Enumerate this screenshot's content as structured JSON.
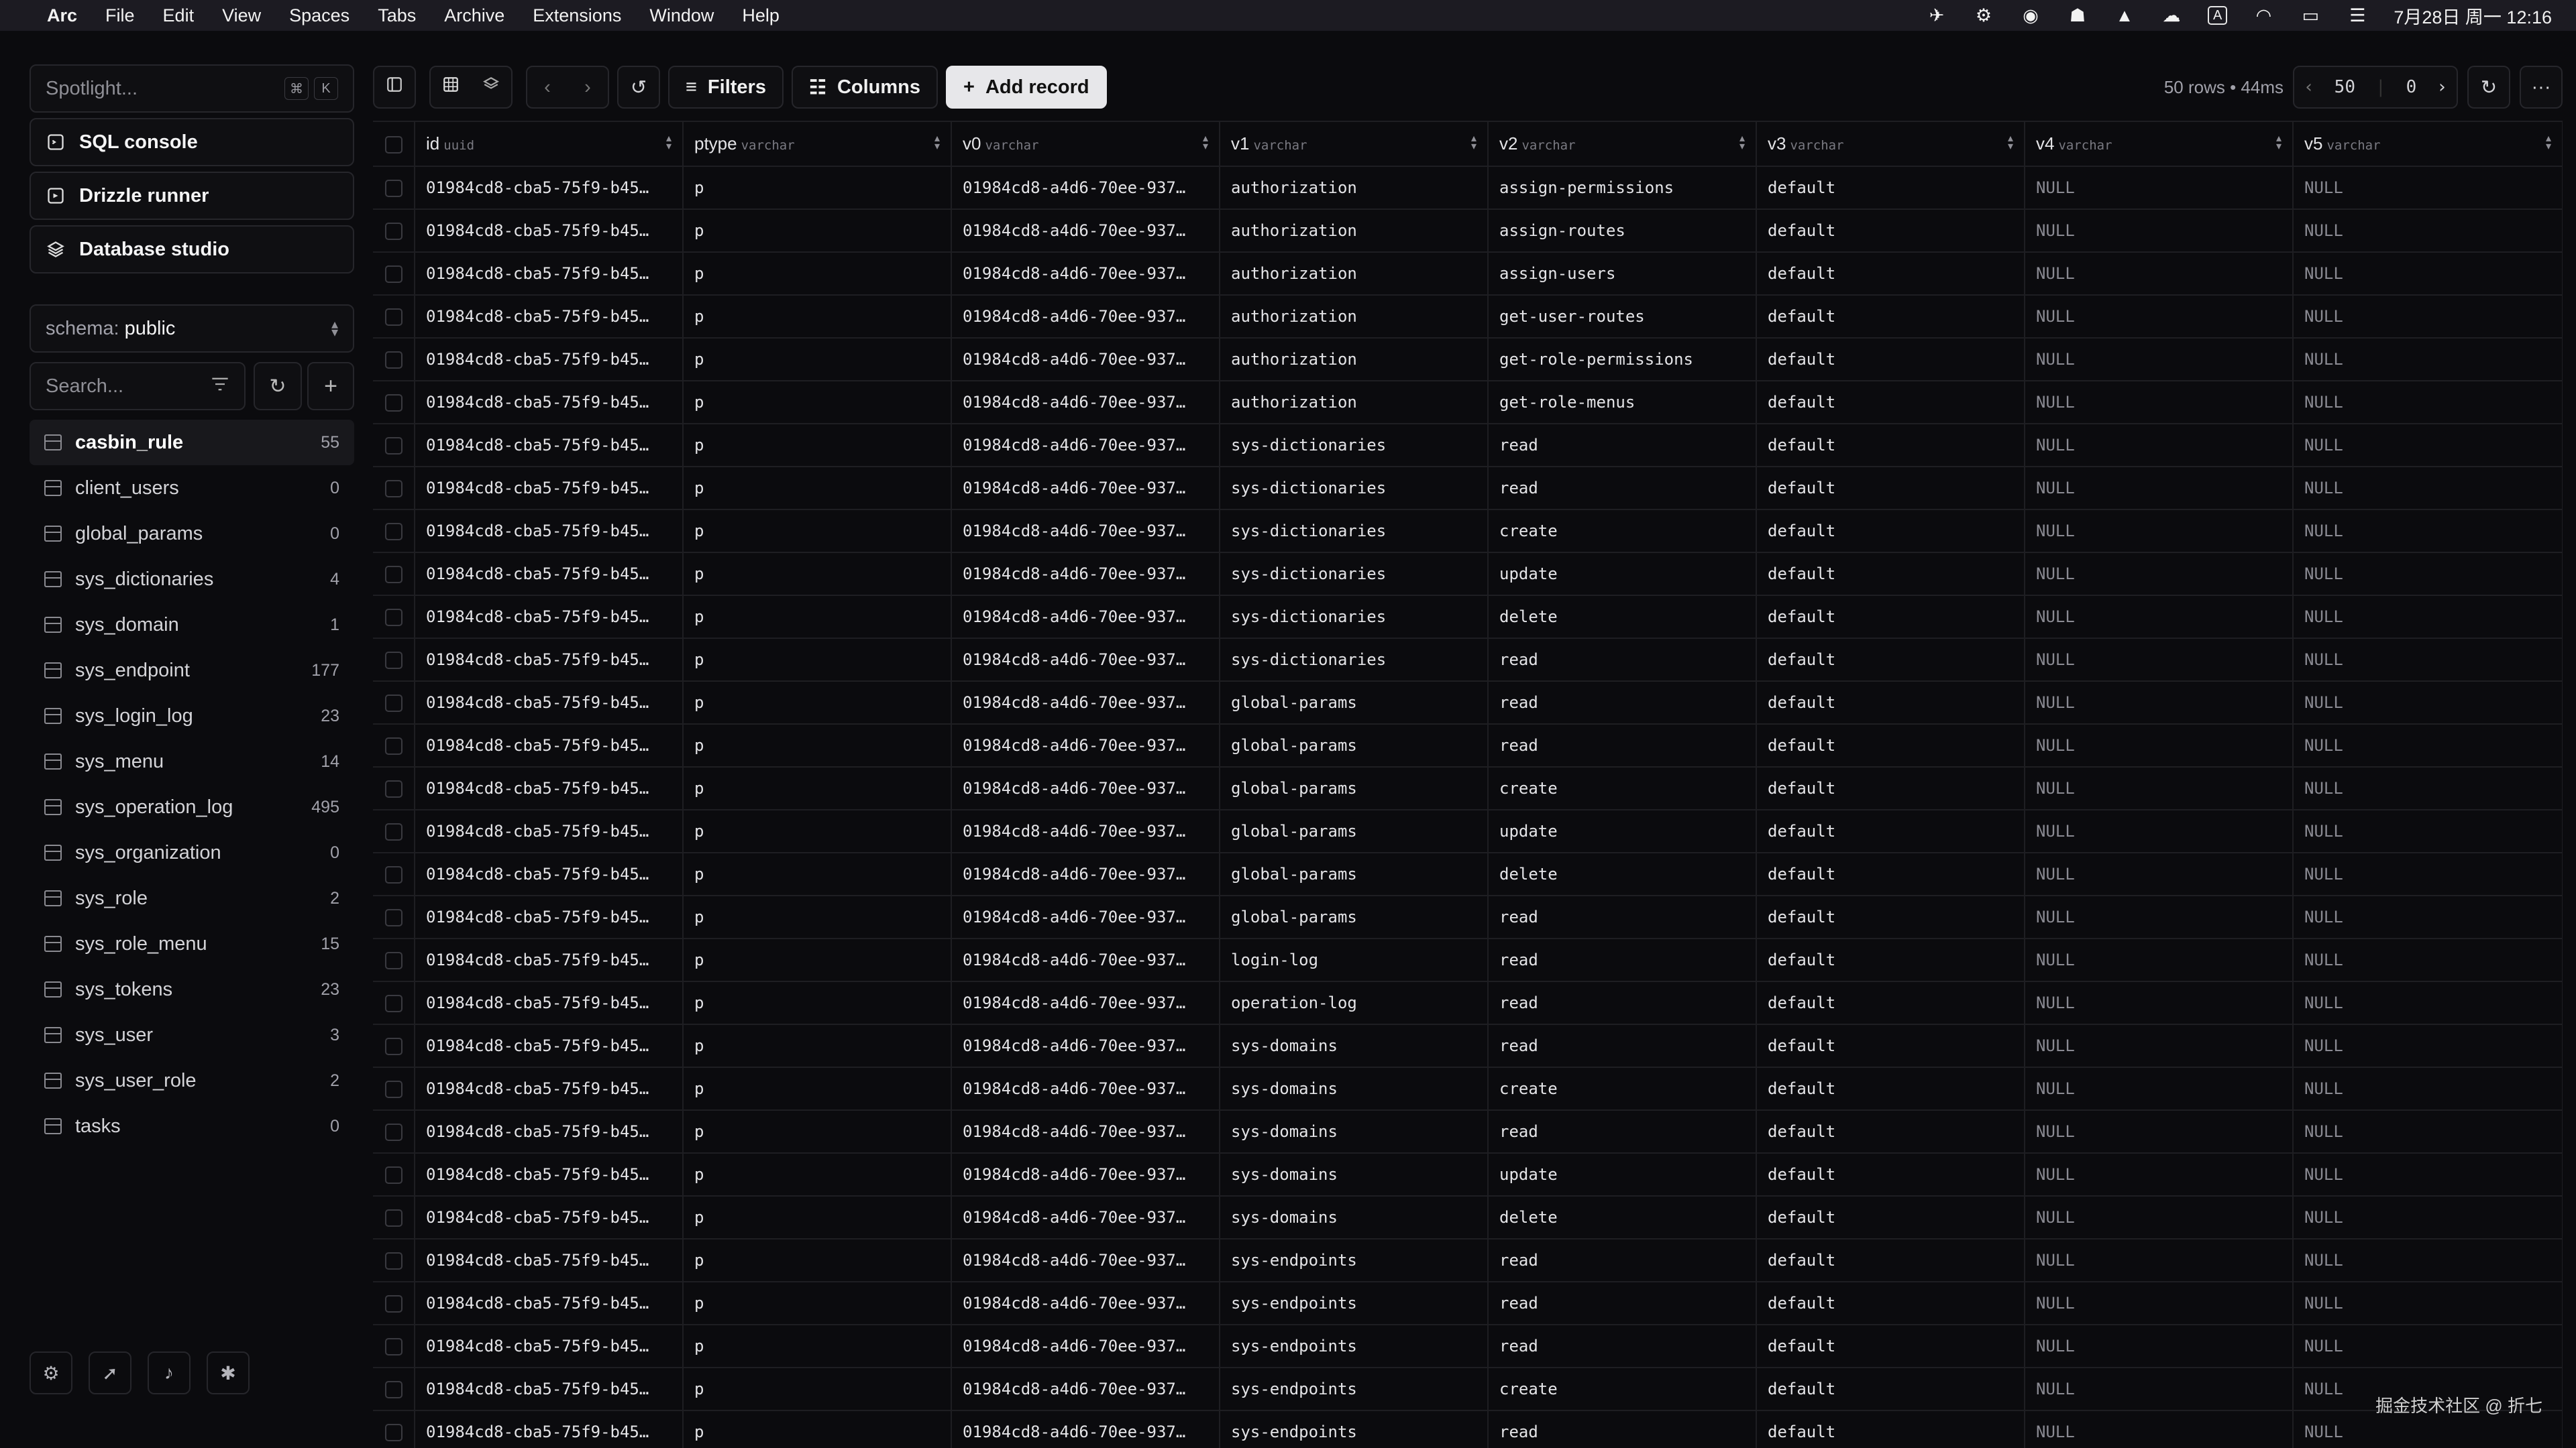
{
  "menubar": {
    "app": "Arc",
    "items": [
      "File",
      "Edit",
      "View",
      "Spaces",
      "Tabs",
      "Archive",
      "Extensions",
      "Window",
      "Help"
    ],
    "ime": "A",
    "clock": "7月28日 周一 12:16"
  },
  "sidebar": {
    "spotlight_placeholder": "Spotlight...",
    "spotlight_kbd": [
      "⌘",
      "K"
    ],
    "nav": [
      {
        "label": "SQL console",
        "icon": "terminal-icon"
      },
      {
        "label": "Drizzle runner",
        "icon": "runner-icon"
      },
      {
        "label": "Database studio",
        "icon": "layers-icon"
      }
    ],
    "schema_label": "schema:",
    "schema_value": "public",
    "search_placeholder": "Search...",
    "tables": [
      {
        "name": "casbin_rule",
        "count": "55"
      },
      {
        "name": "client_users",
        "count": "0"
      },
      {
        "name": "global_params",
        "count": "0"
      },
      {
        "name": "sys_dictionaries",
        "count": "4"
      },
      {
        "name": "sys_domain",
        "count": "1"
      },
      {
        "name": "sys_endpoint",
        "count": "177"
      },
      {
        "name": "sys_login_log",
        "count": "23"
      },
      {
        "name": "sys_menu",
        "count": "14"
      },
      {
        "name": "sys_operation_log",
        "count": "495"
      },
      {
        "name": "sys_organization",
        "count": "0"
      },
      {
        "name": "sys_role",
        "count": "2"
      },
      {
        "name": "sys_role_menu",
        "count": "15"
      },
      {
        "name": "sys_tokens",
        "count": "23"
      },
      {
        "name": "sys_user",
        "count": "3"
      },
      {
        "name": "sys_user_role",
        "count": "2"
      },
      {
        "name": "tasks",
        "count": "0"
      }
    ],
    "bottom_icons": [
      "settings-icon",
      "rocket-icon",
      "bell-icon",
      "bug-icon"
    ]
  },
  "toolbar": {
    "filters": "Filters",
    "columns": "Columns",
    "add_record": "Add record",
    "status": "50 rows • 44ms",
    "limit": "50",
    "offset": "0"
  },
  "table": {
    "columns": [
      {
        "name": "id",
        "type": "uuid"
      },
      {
        "name": "ptype",
        "type": "varchar"
      },
      {
        "name": "v0",
        "type": "varchar"
      },
      {
        "name": "v1",
        "type": "varchar"
      },
      {
        "name": "v2",
        "type": "varchar"
      },
      {
        "name": "v3",
        "type": "varchar"
      },
      {
        "name": "v4",
        "type": "varchar"
      },
      {
        "name": "v5",
        "type": "varchar"
      }
    ],
    "id_value": "01984cd8-cba5-75f9-b45…",
    "ptype_value": "p",
    "v0_value": "01984cd8-a4d6-70ee-937…",
    "v3_value": "default",
    "null_value": "NULL",
    "rows": [
      [
        "authorization",
        "assign-permissions"
      ],
      [
        "authorization",
        "assign-routes"
      ],
      [
        "authorization",
        "assign-users"
      ],
      [
        "authorization",
        "get-user-routes"
      ],
      [
        "authorization",
        "get-role-permissions"
      ],
      [
        "authorization",
        "get-role-menus"
      ],
      [
        "sys-dictionaries",
        "read"
      ],
      [
        "sys-dictionaries",
        "read"
      ],
      [
        "sys-dictionaries",
        "create"
      ],
      [
        "sys-dictionaries",
        "update"
      ],
      [
        "sys-dictionaries",
        "delete"
      ],
      [
        "sys-dictionaries",
        "read"
      ],
      [
        "global-params",
        "read"
      ],
      [
        "global-params",
        "read"
      ],
      [
        "global-params",
        "create"
      ],
      [
        "global-params",
        "update"
      ],
      [
        "global-params",
        "delete"
      ],
      [
        "global-params",
        "read"
      ],
      [
        "login-log",
        "read"
      ],
      [
        "operation-log",
        "read"
      ],
      [
        "sys-domains",
        "read"
      ],
      [
        "sys-domains",
        "create"
      ],
      [
        "sys-domains",
        "read"
      ],
      [
        "sys-domains",
        "update"
      ],
      [
        "sys-domains",
        "delete"
      ],
      [
        "sys-endpoints",
        "read"
      ],
      [
        "sys-endpoints",
        "read"
      ],
      [
        "sys-endpoints",
        "read"
      ],
      [
        "sys-endpoints",
        "create"
      ],
      [
        "sys-endpoints",
        "read"
      ]
    ]
  },
  "watermark": "掘金技术社区 @ 折七"
}
